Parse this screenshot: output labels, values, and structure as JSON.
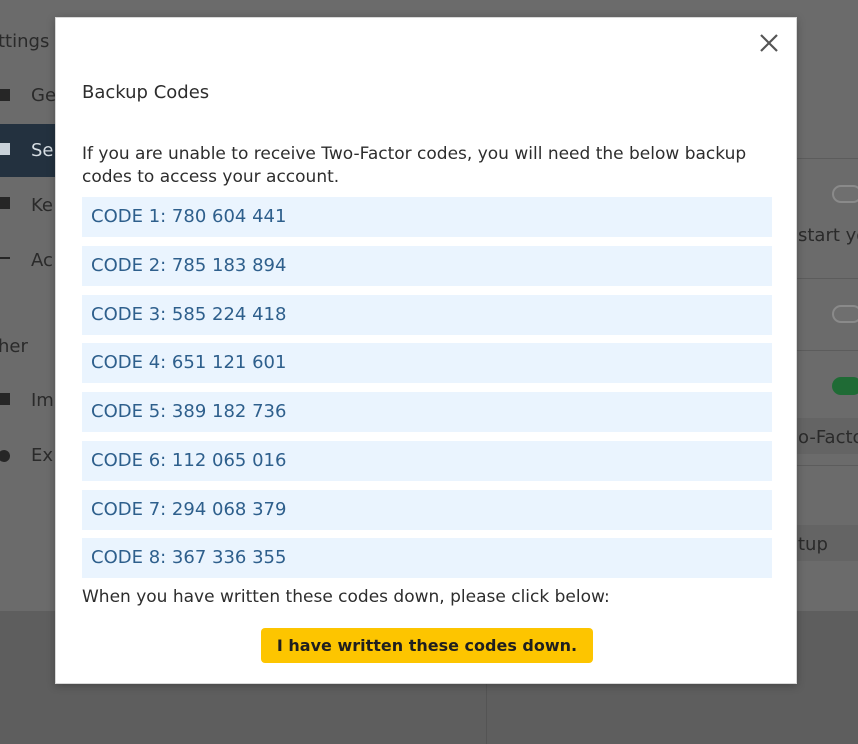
{
  "background": {
    "heading": "ttings",
    "sidebar_items": [
      "Ge",
      "Se",
      "Ke",
      "Ac"
    ],
    "section_heading": "her",
    "other_items": [
      "Im",
      "Ex"
    ],
    "right_snippets": {
      "start_text": "start yo",
      "two_factor_text": "o-Facto",
      "setup_text": "tup"
    }
  },
  "modal": {
    "title": "Backup Codes",
    "description": "If you are unable to receive Two-Factor codes, you will need the below backup codes to access your account.",
    "codes": [
      "CODE 1: 780 604 441",
      "CODE 2: 785 183 894",
      "CODE 3: 585 224 418",
      "CODE 4: 651 121 601",
      "CODE 5: 389 182 736",
      "CODE 6: 112 065 016",
      "CODE 7: 294 068 379",
      "CODE 8: 367 336 355"
    ],
    "footer_text": "When you have written these codes down, please click below:",
    "confirm_label": "I have written these codes down."
  },
  "colors": {
    "accent_button": "#fdc500",
    "code_background": "#eaf4fe",
    "code_text": "#2e5f8c"
  }
}
